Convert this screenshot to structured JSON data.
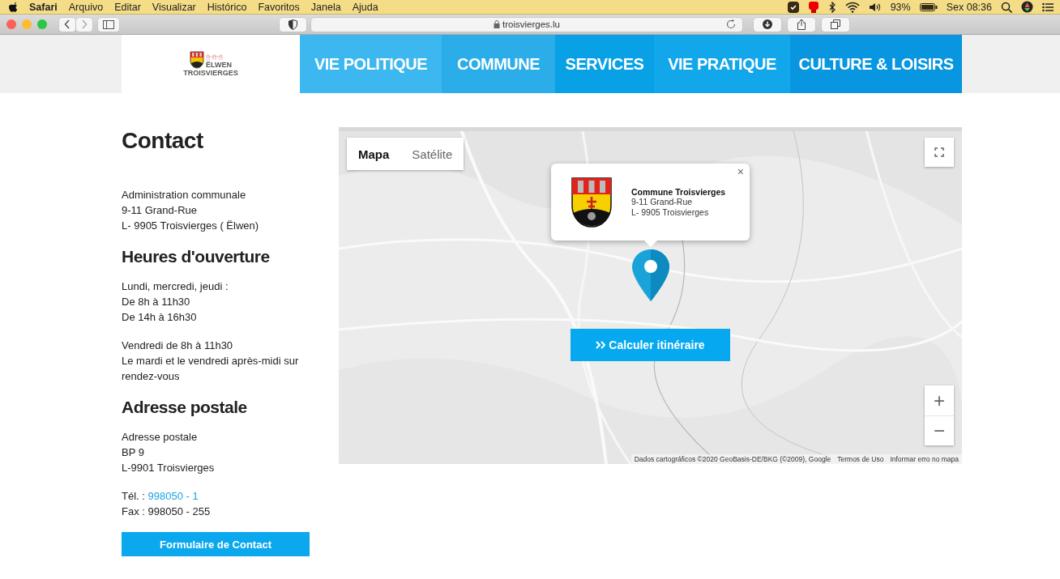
{
  "menubar": {
    "app": "Safari",
    "menus": [
      "Arquivo",
      "Editar",
      "Visualizar",
      "Histórico",
      "Favoritos",
      "Janela",
      "Ajuda"
    ],
    "battery": "93%",
    "clock": "Sex 08:36"
  },
  "toolbar": {
    "url": "troisvierges.lu"
  },
  "logo": {
    "lines": [
      "ËLWEN",
      "TROISVIERGES"
    ]
  },
  "nav": [
    {
      "label": "VIE POLITIQUE",
      "color": "#3db7ef"
    },
    {
      "label": "COMMUNE",
      "color": "#2aade9"
    },
    {
      "label": "SERVICES",
      "color": "#08a1e6"
    },
    {
      "label": "VIE PRATIQUE",
      "color": "#12a6eb"
    },
    {
      "label": "CULTURE & LOISIRS",
      "color": "#0996e0"
    }
  ],
  "contact": {
    "title": "Contact",
    "blocks": [
      {
        "kind": "paragraph",
        "lines": [
          "Administration communale",
          "9-11 Grand-Rue",
          "L- 9905 Troisvierges ( Ëlwen)"
        ]
      },
      {
        "kind": "heading",
        "text": "Heures d'ouverture"
      },
      {
        "kind": "paragraph",
        "lines": [
          "Lundi, mercredi, jeudi :",
          "De 8h à 11h30",
          "De 14h à 16h30"
        ]
      },
      {
        "kind": "paragraph",
        "lines": [
          "Vendredi de 8h à 11h30",
          "Le mardi et le vendredi après-midi sur rendez-vous"
        ]
      },
      {
        "kind": "heading",
        "text": "Adresse postale"
      },
      {
        "kind": "paragraph",
        "lines": [
          "Adresse postale",
          "BP 9",
          "L-9901 Troisvierges"
        ]
      },
      {
        "kind": "phone",
        "label": "Tél. :",
        "number": "998050 - 1",
        "fax": "Fax : 998050 - 255"
      },
      {
        "kind": "button",
        "text": "Formulaire de Contact"
      }
    ]
  },
  "map": {
    "types": [
      {
        "label": "Mapa",
        "selected": true
      },
      {
        "label": "Satélite",
        "selected": false
      }
    ],
    "popup": {
      "close": "×",
      "title": "Commune Troisvierges",
      "lines": [
        "9-11 Grand-Rue",
        "L- 9905 Troisvierges"
      ]
    },
    "route_button": "Calculer itinéraire",
    "zoom_in": "+",
    "zoom_out": "−",
    "attribution": [
      "Dados cartográficos ©2020 GeoBasis-DE/BKG (©2009), Google",
      "Termos de Uso",
      "Informar erro no mapa"
    ]
  }
}
